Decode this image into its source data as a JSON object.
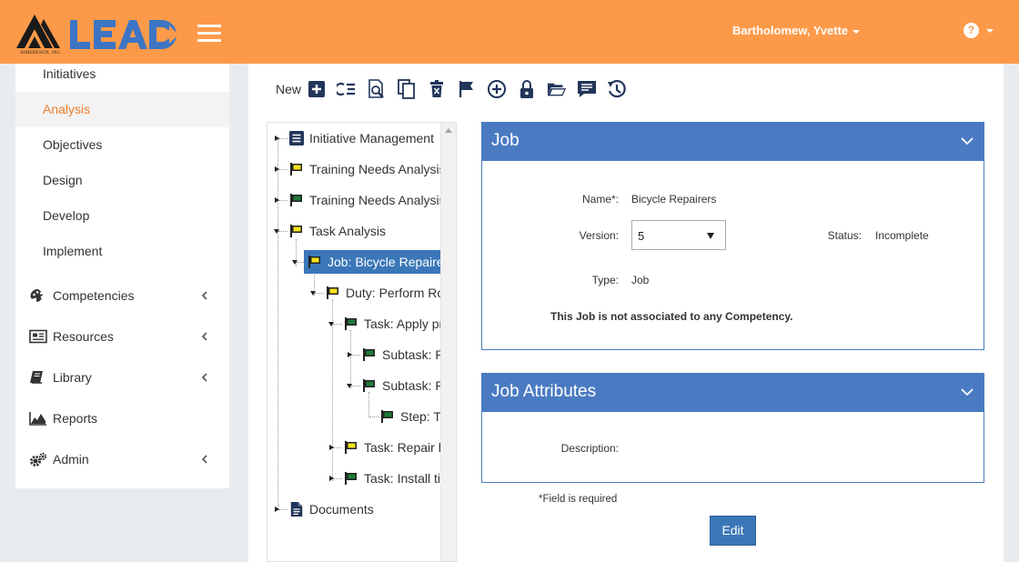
{
  "app": {
    "brand": "LEAD",
    "brand_sub": "AIMERESON, INC."
  },
  "header": {
    "user_name": "Bartholomew, Yvette",
    "help_glyph": "?"
  },
  "sidebar": {
    "sub_items": [
      {
        "label": "Initiatives",
        "active": false
      },
      {
        "label": "Analysis",
        "active": true
      },
      {
        "label": "Objectives",
        "active": false
      },
      {
        "label": "Design",
        "active": false
      },
      {
        "label": "Develop",
        "active": false
      },
      {
        "label": "Implement",
        "active": false
      }
    ],
    "nav_items": [
      {
        "label": "Competencies",
        "icon": "palette-icon",
        "has_chevron": true
      },
      {
        "label": "Resources",
        "icon": "newspaper-icon",
        "has_chevron": true
      },
      {
        "label": "Library",
        "icon": "book-icon",
        "has_chevron": true
      },
      {
        "label": "Reports",
        "icon": "area-chart-icon",
        "has_chevron": false
      },
      {
        "label": "Admin",
        "icon": "gears-icon",
        "has_chevron": true
      }
    ]
  },
  "toolbar": {
    "new_label": "New",
    "buttons": [
      "add-icon",
      "checklist-icon",
      "inspect-icon",
      "copy-icon",
      "delete-icon",
      "flag-icon",
      "plus-circle-icon",
      "lock-icon",
      "folder-open-icon",
      "comment-icon",
      "history-icon"
    ]
  },
  "tree": {
    "nodes": [
      {
        "label": "Initiative Management",
        "icon": "list-doc-icon"
      },
      {
        "label": "Training Needs Analysis (C",
        "icon": "flag-yellow-icon"
      },
      {
        "label": "Training Needs Analysis",
        "icon": "flag-green-icon"
      },
      {
        "label": "Task Analysis",
        "icon": "flag-yellow-icon"
      },
      {
        "label": "Job: Bicycle Repairers",
        "icon": "flag-yellow-icon"
      },
      {
        "label": "Duty: Perform Routi",
        "icon": "flag-yellow-icon"
      },
      {
        "label": "Task: Apply princ",
        "icon": "flag-green-icon"
      },
      {
        "label": "Subtask: Ren",
        "icon": "flag-green-icon"
      },
      {
        "label": "Subtask: Ren",
        "icon": "flag-green-icon"
      },
      {
        "label": "Step: Twis",
        "icon": "flag-green-icon"
      },
      {
        "label": "Task: Repair hole",
        "icon": "flag-yellow-icon"
      },
      {
        "label": "Task: Install tires",
        "icon": "flag-green-icon"
      },
      {
        "label": "Documents",
        "icon": "document-icon"
      }
    ]
  },
  "job_panel": {
    "title": "Job",
    "name_label": "Name*:",
    "name_value": "Bicycle Repairers",
    "version_label": "Version:",
    "version_value": "5",
    "status_label": "Status:",
    "status_value": "Incomplete",
    "type_label": "Type:",
    "type_value": "Job",
    "competency_note": "This Job is not associated to any Competency."
  },
  "attributes_panel": {
    "title": "Job Attributes",
    "description_label": "Description:"
  },
  "footer": {
    "required_note": "*Field is required",
    "edit_label": "Edit"
  },
  "colors": {
    "header": "#fd9a49",
    "accent_blue": "#4a7bc2",
    "active_text": "#ec7d2c",
    "flag_yellow": "#f6e21b",
    "flag_green": "#1f7a3a"
  }
}
